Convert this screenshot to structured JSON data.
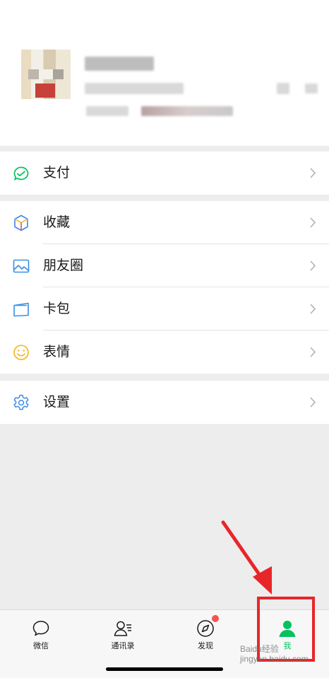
{
  "menu": {
    "pay": "支付",
    "favorites": "收藏",
    "moments": "朋友圈",
    "cards": "卡包",
    "stickers": "表情",
    "settings": "设置"
  },
  "tabbar": {
    "chats": "微信",
    "contacts": "通讯录",
    "discover": "发现",
    "me": "我",
    "active": "me",
    "discover_badge": true
  },
  "watermark": "Baidu经验",
  "watermark_url": "jingyan.baidu.com",
  "colors": {
    "accent": "#07c160",
    "annotation": "#e8262a",
    "badge": "#fa5151"
  }
}
